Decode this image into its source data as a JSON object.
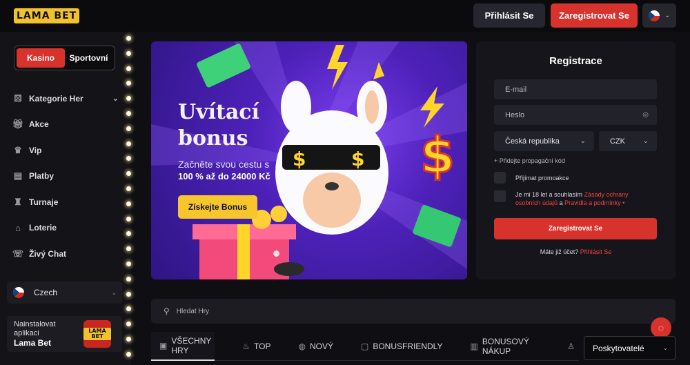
{
  "header": {
    "logo": "LAMA BET",
    "login_label": "Přihlásit Se",
    "register_label": "Zaregistrovat Se"
  },
  "sidebar": {
    "toggle": {
      "active": "Kasino",
      "inactive": "Sportovní"
    },
    "items": [
      {
        "label": "Kategorie Her",
        "icon": "dice-icon"
      },
      {
        "label": "Akce",
        "icon": "gift-icon"
      },
      {
        "label": "Vip",
        "icon": "crown-icon"
      },
      {
        "label": "Platby",
        "icon": "wallet-icon"
      },
      {
        "label": "Turnaje",
        "icon": "trophy-icon"
      },
      {
        "label": "Loterie",
        "icon": "lottery-icon"
      },
      {
        "label": "Živý Chat",
        "icon": "chat-icon"
      }
    ],
    "language": "Czech",
    "app": {
      "line1": "Nainstalovat",
      "line2": "aplikaci",
      "name": "Lama Bet",
      "icon_text": "LAMA BET"
    }
  },
  "banner": {
    "title_line1": "Uvítací",
    "title_line2": "bonus",
    "subtitle": "Začněte svou cestu s",
    "amount": "100 % až do 24000 Kč",
    "cta": "Získejte Bonus",
    "colors": {
      "bg": "#4d21b8",
      "button": "#f7c52c"
    }
  },
  "registration": {
    "title": "Registrace",
    "email_placeholder": "E-mail",
    "password_placeholder": "Heslo",
    "country": "Česká republika",
    "currency": "CZK",
    "promo_link": "+ Přidejte propagační kód",
    "accept_promo": "Přijímat promoakce",
    "terms_prefix": "Je mi 18 let a souhlasím",
    "terms_link1": "Zásady ochrany osobních údajů",
    "terms_and": "a",
    "terms_link2": "Pravidla a podmínky",
    "terms_suffix": "•",
    "submit": "Zaregistrovat Se",
    "have_account": "Máte již účet?",
    "login_link": "Přihlásit Se"
  },
  "search": {
    "placeholder": "Hledat Hry"
  },
  "tabs": [
    {
      "label": "VŠECHNY HRY",
      "icon": "grid-icon"
    },
    {
      "label": "TOP",
      "icon": "fire-icon"
    },
    {
      "label": "NOVÝ",
      "icon": "new-icon"
    },
    {
      "label": "BONUSFRIENDLY",
      "icon": "bonus-icon"
    },
    {
      "label": "BONUSOVÝ NÁKUP",
      "icon": "cart-icon"
    }
  ],
  "providers": "Poskytovatelé",
  "colors": {
    "accent": "#d8322d",
    "brand_yellow": "#f2c12e",
    "background": "#0f0f13"
  }
}
